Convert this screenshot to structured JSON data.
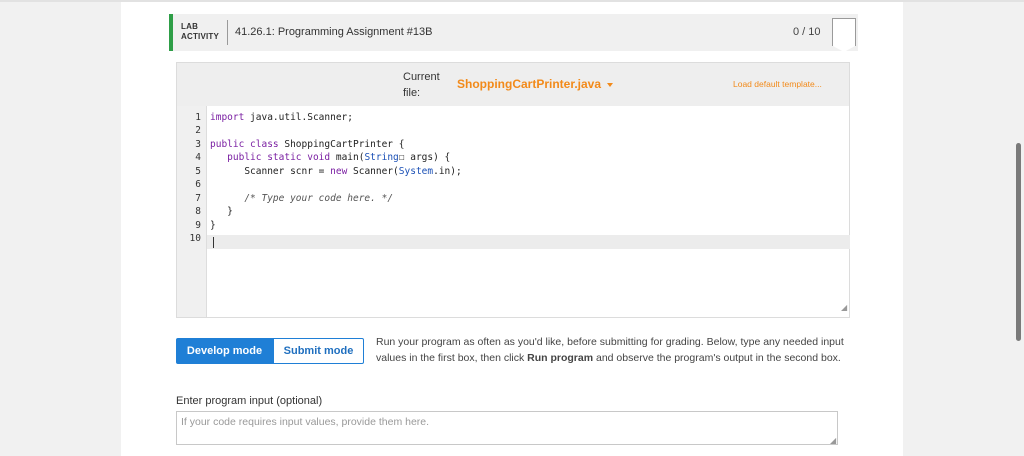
{
  "lab": {
    "tag_line1": "LAB",
    "tag_line2": "ACTIVITY",
    "title": "41.26.1: Programming Assignment #13B",
    "score": "0 / 10"
  },
  "file_bar": {
    "label_line1": "Current",
    "label_line2": "file:",
    "file_name": "ShoppingCartPrinter.java",
    "load_template": "Load default template..."
  },
  "editor": {
    "line_numbers": [
      "1",
      "2",
      "3",
      "4",
      "5",
      "6",
      "7",
      "8",
      "9",
      "10"
    ],
    "lines": {
      "l1": {
        "kw": "import",
        "rest": " java.util.Scanner;"
      },
      "l3": {
        "kw": "public class",
        "rest": " ShoppingCartPrinter {"
      },
      "l4": {
        "indent": "   ",
        "kw": "public static void",
        "rest": " main(",
        "ty": "String",
        "rest2": "☐ args) {"
      },
      "l5": {
        "indent": "      ",
        "rest": "Scanner scnr = ",
        "kw": "new",
        "rest2": " Scanner(",
        "ty": "System",
        "rest3": ".in);"
      },
      "l7": {
        "indent": "      ",
        "comment": "/* Type your code here. */"
      },
      "l8": {
        "indent": "   ",
        "rest": "}"
      },
      "l9": {
        "rest": "}"
      }
    }
  },
  "modes": {
    "develop": "Develop mode",
    "submit": "Submit mode"
  },
  "description": {
    "part1": "Run your program as often as you'd like, before submitting for grading. Below, type any needed input values in the first box, then click ",
    "bold": "Run program",
    "part2": " and observe the program's output in the second box."
  },
  "input": {
    "label": "Enter program input (optional)",
    "placeholder": "If your code requires input values, provide them here."
  },
  "colors": {
    "accent_green": "#2e9e47",
    "accent_orange": "#f28a1a",
    "accent_blue": "#1f7fd6"
  }
}
